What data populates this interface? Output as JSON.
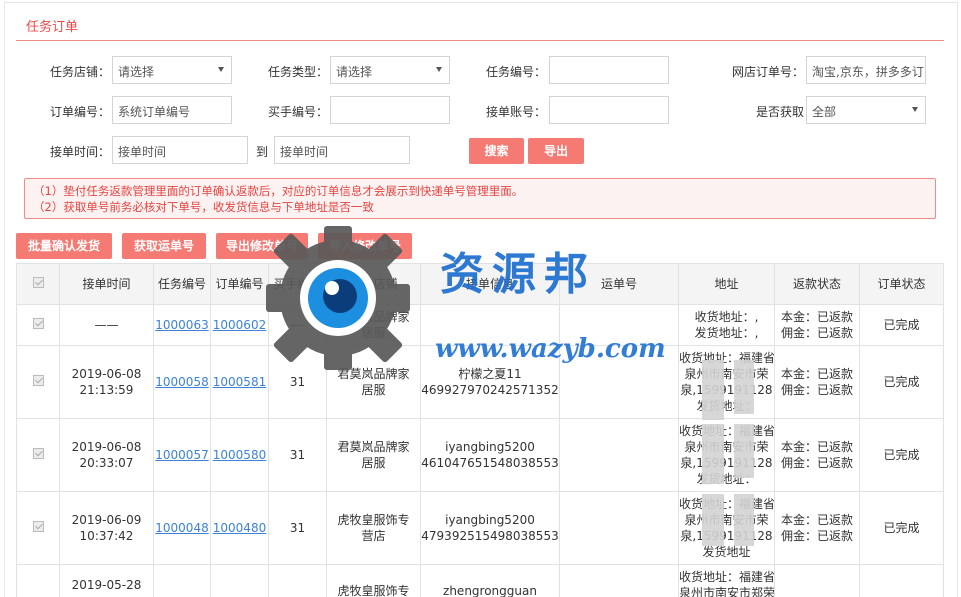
{
  "header": {
    "title": "任务订单"
  },
  "filters": {
    "store_label": "任务店铺：",
    "store_value": "请选择",
    "type_label": "任务类型：",
    "type_value": "请选择",
    "task_no_label": "任务编号：",
    "task_no_value": "",
    "shop_order_label": "网店订单号：",
    "shop_order_placeholder": "淘宝,京东，拼多多订",
    "order_no_label": "订单编号：",
    "order_no_placeholder": "系统订单编号",
    "buyer_no_label": "买手编号：",
    "buyer_no_value": "",
    "account_label": "接单账号：",
    "account_value": "",
    "obtained_label": "是否获取",
    "obtained_value": "全部",
    "time_label": "接单时间：",
    "time_from_placeholder": "接单时间",
    "to_label": "到",
    "time_to_placeholder": "接单时间",
    "search_btn": "搜索",
    "export_btn": "导出"
  },
  "notice": {
    "line1": "（1）垫付任务返款管理里面的订单确认返款后，对应的订单信息才会展示到快递单号管理里面。",
    "line2": "（2）获取单号前务必核对下单号，收发货信息与下单地址是否一致"
  },
  "actions": {
    "batch_confirm": "批量确认发货",
    "get_waybill": "获取运单号",
    "export_modify": "导出修改单号",
    "import_modify": "导入修改单号"
  },
  "table": {
    "headers": [
      "接单时间",
      "任务编号",
      "订单编号",
      "买手编号",
      "任务店铺",
      "接单信息",
      "运单号",
      "地址",
      "返款状态",
      "订单状态"
    ],
    "rows": [
      {
        "time1": "——",
        "time2": "",
        "task": "1000063",
        "order": "1000602",
        "buyer": "—",
        "store1": "君莫岚品牌家",
        "store2": "居服",
        "info1": "",
        "info2": "",
        "waybill": "",
        "addr": [
          "收货地址：,",
          "发货地址：,"
        ],
        "refund1": "本金：已返款",
        "refund2": "佣金：已返款",
        "status": "已完成"
      },
      {
        "time1": "2019-06-08",
        "time2": "21:13:59",
        "task": "1000058",
        "order": "1000581",
        "buyer": "31",
        "store1": "君莫岚品牌家",
        "store2": "居服",
        "info1": "柠檬之夏11",
        "info2": "469927970242571352",
        "waybill": "",
        "addr": [
          "收货地址：福建省",
          "泉州市南安市荣",
          "泉,1599191128",
          "发货地址："
        ],
        "refund1": "本金：已返款",
        "refund2": "佣金：已返款",
        "status": "已完成"
      },
      {
        "time1": "2019-06-08",
        "time2": "20:33:07",
        "task": "1000057",
        "order": "1000580",
        "buyer": "31",
        "store1": "君莫岚品牌家",
        "store2": "居服",
        "info1": "iyangbing5200",
        "info2": "461047651548038553",
        "waybill": "",
        "addr": [
          "收货地址：福建省",
          "泉州市南安市荣",
          "泉,1599191128",
          "发货地址："
        ],
        "refund1": "本金：已返款",
        "refund2": "佣金：已返款",
        "status": "已完成"
      },
      {
        "time1": "2019-06-09",
        "time2": "10:37:42",
        "task": "1000048",
        "order": "1000480",
        "buyer": "31",
        "store1": "虎牧皇服饰专",
        "store2": "营店",
        "info1": "iyangbing5200",
        "info2": "479392515498038553",
        "waybill": "",
        "addr": [
          "收货地址：福建省",
          "泉州市南安市荣",
          "泉,1599191128",
          "发货地址"
        ],
        "refund1": "本金：已返款",
        "refund2": "佣金：已返款",
        "status": "已完成"
      },
      {
        "time1": "2019-05-28",
        "time2": "",
        "task": "",
        "order": "",
        "buyer": "",
        "store1": "虎牧皇服饰专",
        "store2": "",
        "info1": "zhengrongguan",
        "info2": "",
        "waybill": "",
        "addr": [
          "收货地址：福建省",
          "泉州市南安市郑荣"
        ],
        "refund1": "",
        "refund2": "",
        "status": ""
      }
    ]
  },
  "watermark": {
    "text": "资源邦",
    "url": "www.wazyb.com"
  },
  "colors": {
    "accent": "#f57a73",
    "title": "#ea4a47",
    "link": "#3d82d6",
    "watermark": "#1d6fd0"
  }
}
